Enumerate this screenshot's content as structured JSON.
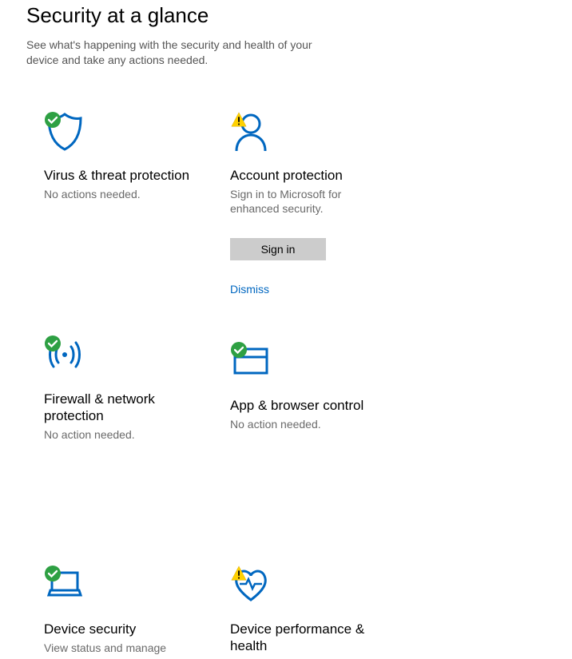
{
  "page": {
    "title": "Security at a glance",
    "subtitle": "See what's happening with the security and health of your device and take any actions needed."
  },
  "tiles": {
    "virus": {
      "title": "Virus & threat protection",
      "desc": "No actions needed."
    },
    "account": {
      "title": "Account protection",
      "desc": "Sign in to Microsoft for enhanced security.",
      "button": "Sign in",
      "dismiss": "Dismiss"
    },
    "firewall": {
      "title": "Firewall & network protection",
      "desc": "No action needed."
    },
    "app": {
      "title": "App & browser control",
      "desc": "No action needed."
    },
    "device": {
      "title": "Device security",
      "desc": "View status and manage"
    },
    "perf": {
      "title": "Device performance & health",
      "desc": ""
    }
  }
}
